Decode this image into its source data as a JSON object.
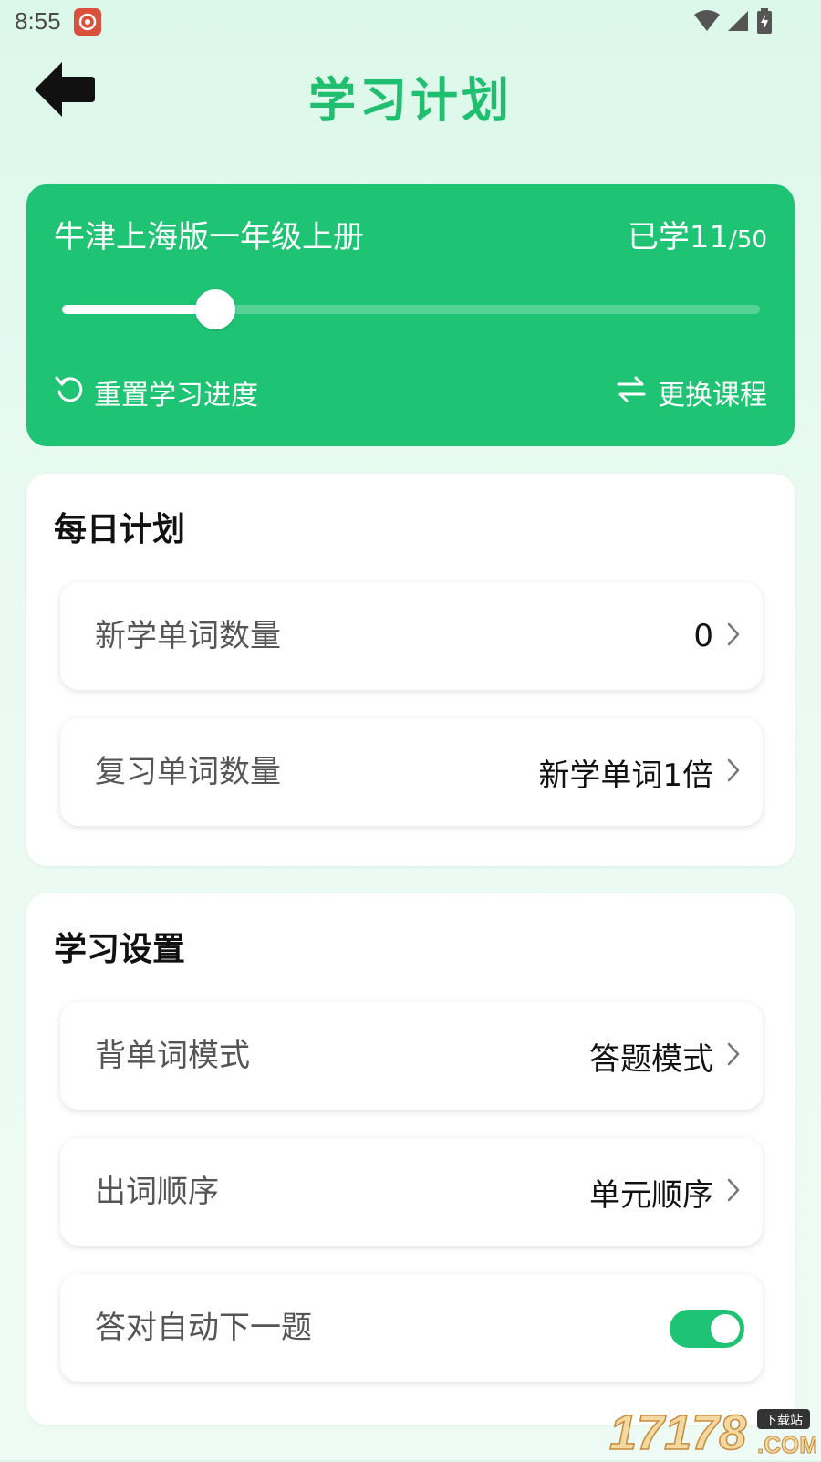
{
  "status_bar": {
    "time": "8:55"
  },
  "header": {
    "title": "学习计划",
    "back_icon": "arrow-left-icon"
  },
  "course": {
    "name": "牛津上海版一年级上册",
    "progress_prefix": "已学11",
    "progress_total": "/50",
    "learned": 11,
    "total": 50,
    "slider_fraction": 0.22,
    "reset_label": "重置学习进度",
    "reset_icon": "refresh-icon",
    "switch_label": "更换课程",
    "switch_icon": "swap-icon",
    "color": "#1fc374"
  },
  "daily_plan": {
    "title": "每日计划",
    "rows": [
      {
        "label": "新学单词数量",
        "value": "0"
      },
      {
        "label": "复习单词数量",
        "value": "新学单词1倍"
      }
    ]
  },
  "study_settings": {
    "title": "学习设置",
    "rows": [
      {
        "label": "背单词模式",
        "value": "答题模式"
      },
      {
        "label": "出词顺序",
        "value": "单元顺序"
      }
    ],
    "toggle_row": {
      "label": "答对自动下一题",
      "on": true
    }
  },
  "watermark": {
    "text": "17178",
    "domain": ".COM",
    "tag": "下载站"
  },
  "colors": {
    "accent": "#1fc374",
    "title_green": "#1fbf6f",
    "background": "#e6faf0"
  }
}
